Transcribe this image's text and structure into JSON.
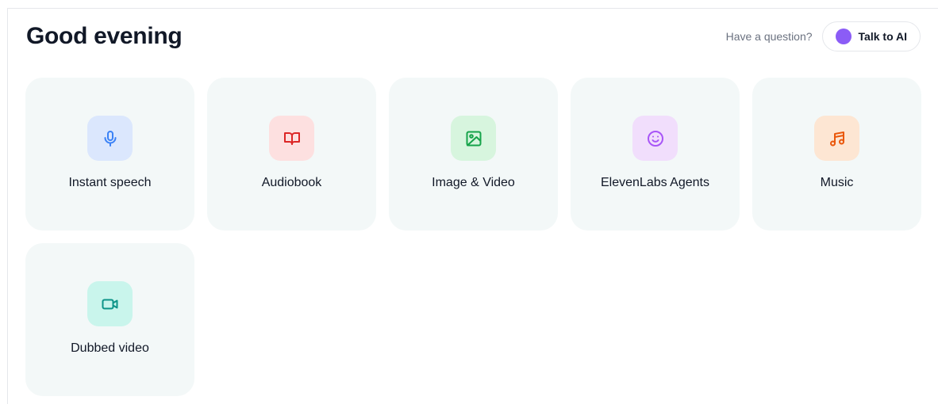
{
  "header": {
    "greeting": "Good evening",
    "help_text": "Have a question?",
    "talk_button_label": "Talk to AI"
  },
  "cards": [
    {
      "label": "Instant speech",
      "icon": "microphone-icon",
      "tile_bg": "#dbe7fd",
      "icon_color": "#3b82f6"
    },
    {
      "label": "Audiobook",
      "icon": "book-open-icon",
      "tile_bg": "#fde0e0",
      "icon_color": "#dc2626"
    },
    {
      "label": "Image & Video",
      "icon": "image-icon",
      "tile_bg": "#d7f5de",
      "icon_color": "#16a34a"
    },
    {
      "label": "ElevenLabs Agents",
      "icon": "smile-icon",
      "tile_bg": "#f1defc",
      "icon_color": "#a855f7"
    },
    {
      "label": "Music",
      "icon": "music-note-icon",
      "tile_bg": "#fde6d3",
      "icon_color": "#ea580c"
    },
    {
      "label": "Dubbed video",
      "icon": "video-camera-icon",
      "tile_bg": "#c9f5ec",
      "icon_color": "#0d9488"
    }
  ]
}
